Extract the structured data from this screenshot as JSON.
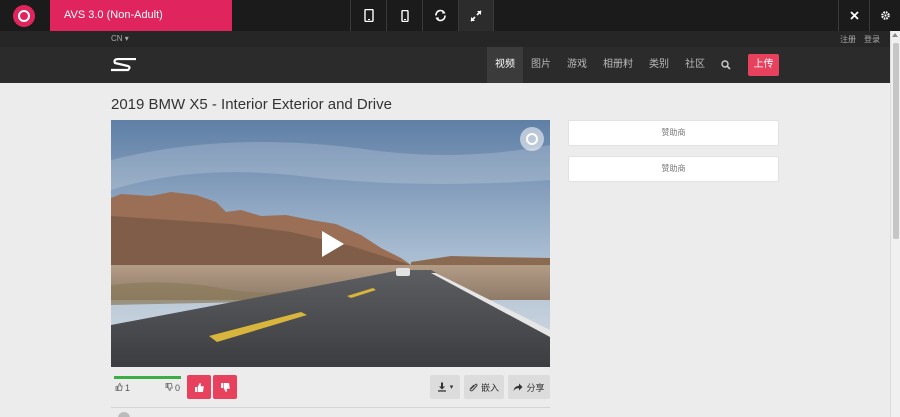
{
  "toolbar": {
    "product_label": "AVS 3.0 (Non-Adult)",
    "devices": [
      {
        "name": "tablet-icon"
      },
      {
        "name": "mobile-icon"
      },
      {
        "name": "rotate-icon"
      },
      {
        "name": "fullscreen-icon"
      }
    ],
    "close_icon": "close-icon",
    "settings_icon": "gear-icon"
  },
  "site": {
    "language": "CN ▾",
    "register": "注册",
    "login": "登录",
    "nav": [
      "视频",
      "图片",
      "游戏",
      "相册籿",
      "类别",
      "社区"
    ],
    "active_nav": 0,
    "upload": "上传",
    "accent": "#e8415d"
  },
  "video": {
    "title": "2019 BMW X5 - Interior Exterior and Drive",
    "likes": "1",
    "dislikes": "0",
    "rating": 1.0,
    "like_icon": "thumbs-up-icon",
    "dislike_icon": "thumbs-down-icon",
    "download_icon": "download-icon",
    "embed": "嵌入",
    "share": "分享"
  },
  "ads": [
    "赞助商",
    "赞助商"
  ]
}
